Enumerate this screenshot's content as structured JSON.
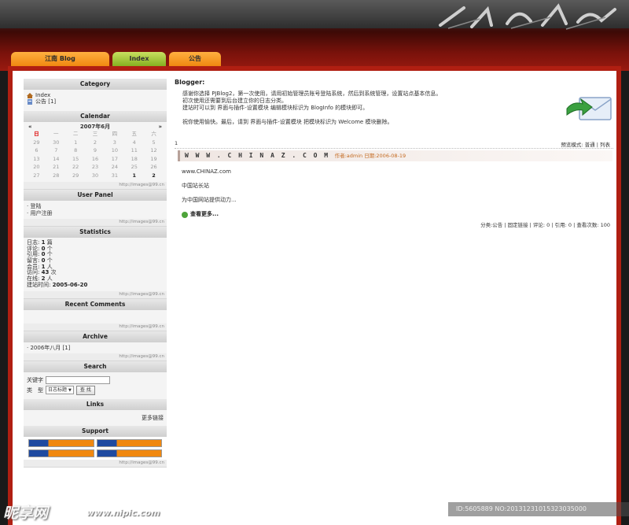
{
  "tabs": [
    {
      "label": "江南 Blog"
    },
    {
      "label": "Index"
    },
    {
      "label": "公告"
    }
  ],
  "sidebar": {
    "category": {
      "title": "Category",
      "items": [
        {
          "label": "Index",
          "icon": "home-icon"
        },
        {
          "label": "公告 [1]",
          "icon": "doc-icon"
        }
      ]
    },
    "calendar": {
      "title": "Calendar",
      "prev": "«",
      "next": "»",
      "month": "2007年6月",
      "weekdays": [
        "日",
        "一",
        "二",
        "三",
        "四",
        "五",
        "六"
      ],
      "days": [
        "29",
        "30",
        "1",
        "2",
        "3",
        "4",
        "5",
        "6",
        "7",
        "8",
        "9",
        "10",
        "11",
        "12",
        "13",
        "14",
        "15",
        "16",
        "17",
        "18",
        "19",
        "20",
        "21",
        "22",
        "23",
        "24",
        "25",
        "26",
        "27",
        "28",
        "29",
        "30",
        "31",
        "1",
        "2"
      ]
    },
    "user_panel": {
      "title": "User Panel",
      "items": [
        "登陆",
        "用户注册"
      ]
    },
    "statistics": {
      "title": "Statistics",
      "rows": [
        {
          "label": "日志:",
          "value": "1",
          "unit": "篇"
        },
        {
          "label": "评论:",
          "value": "0",
          "unit": "个"
        },
        {
          "label": "引用:",
          "value": "0",
          "unit": "个"
        },
        {
          "label": "留言:",
          "value": "0",
          "unit": "个"
        },
        {
          "label": "会员:",
          "value": "1",
          "unit": "人"
        },
        {
          "label": "访问:",
          "value": "43",
          "unit": "次"
        },
        {
          "label": "在线:",
          "value": "2",
          "unit": "人"
        },
        {
          "label": "建站时间:",
          "value": "2005-06-20",
          "unit": ""
        }
      ]
    },
    "recent_comments": {
      "title": "Recent Comments"
    },
    "archive": {
      "title": "Archive",
      "items": [
        "2006年八月 [1]"
      ]
    },
    "search": {
      "title": "Search",
      "keyword_label": "关键字",
      "type_label": "类　型",
      "type_value": "日志标题",
      "button": "查 找"
    },
    "links": {
      "title": "Links",
      "more": "更多链接"
    },
    "support": {
      "title": "Support"
    },
    "foot_text": "http://images@99.cn"
  },
  "main": {
    "welcome_title": "Blogger:",
    "welcome_lines": [
      "感谢你选择 PJBlog2，第一次使用，请用初始管理员账号登陆系统，然后到系统管理，设置站点基本信息。",
      "初次使用还需要到后台建立你的日志分类。",
      "建站时可以到 界面与插件-设置模块 编辑模块标识为 BlogInfo 的模块即可。",
      "",
      "祝你使用愉快。最后，请到 界面与插件-设置模块 把模块标识为 Welcome 模块删除。"
    ],
    "toolbar_left": "1",
    "toolbar_right": "预览模式: 普通 | 列表",
    "post": {
      "title": "W W W . C H I N A Z . C O M",
      "meta": "作者:admin 日期:2006-08-19",
      "body": [
        "www.CHINAZ.com",
        "中国站长站",
        "为中国网站提供动力..."
      ],
      "more": "查看更多...",
      "footer": "分类:公告 | 固定链接 | 评论: 0 | 引用: 0 | 查看次数: 100"
    }
  },
  "watermark": {
    "id_text": "ID:5605889 NO:20131231015323035000",
    "logo": "昵享网",
    "url": "www.nipic.com"
  }
}
